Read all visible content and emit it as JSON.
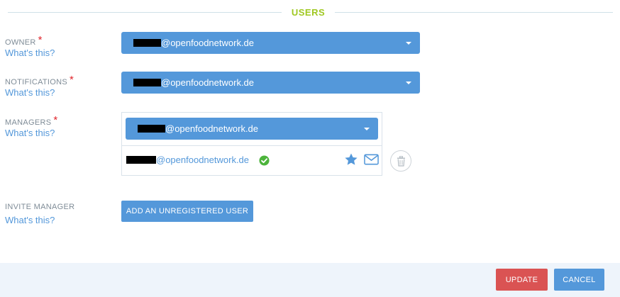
{
  "section": {
    "title": "USERS"
  },
  "owner": {
    "label": "OWNER",
    "required_mark": "*",
    "help": "What's this?",
    "value_suffix": "@openfoodnetwork.de"
  },
  "notifications": {
    "label": "NOTIFICATIONS",
    "required_mark": "*",
    "help": "What's this?",
    "value_suffix": "@openfoodnetwork.de"
  },
  "managers": {
    "label": "MANAGERS",
    "required_mark": "*",
    "help": "What's this?",
    "select_value_suffix": "@openfoodnetwork.de",
    "items": [
      {
        "email_suffix": "@openfoodnetwork.de",
        "confirmed_icon": "check-circle-icon",
        "owner_icon": "star-icon",
        "contact_icon": "envelope-icon"
      }
    ]
  },
  "invite_manager": {
    "label": "INVITE MANAGER",
    "help": "What's this?",
    "button": "ADD AN UNREGISTERED USER"
  },
  "footer": {
    "update": "UPDATE",
    "cancel": "CANCEL"
  },
  "colors": {
    "primary": "#5498da",
    "danger": "#da5353",
    "accent": "#9fc820",
    "success": "#4cb43b"
  }
}
